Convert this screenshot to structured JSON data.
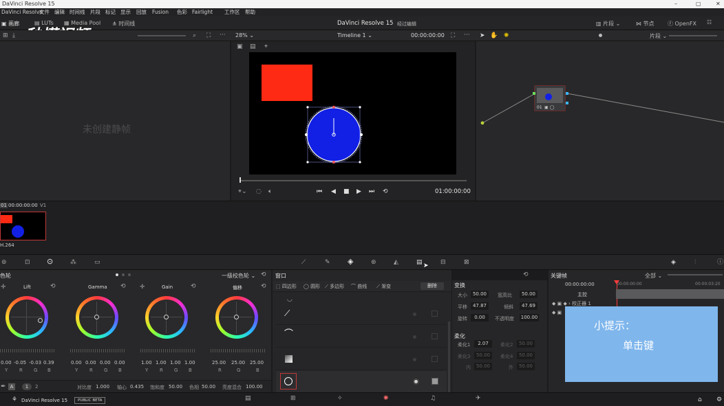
{
  "window": {
    "title": "DaVinci Resolve 15",
    "controls": [
      "–",
      "▢",
      "✕"
    ]
  },
  "menu": [
    "DaVinci Resolve",
    "文件",
    "编辑",
    "时间线",
    "片段",
    "标记",
    "显示",
    "回放",
    "Fusion",
    "色彩",
    "Fairlight",
    "工作区",
    "帮助"
  ],
  "topbar": {
    "left_tabs": [
      "画廊",
      "LUTs",
      "Media Pool",
      "时间线"
    ],
    "project_title": "DaVinci Resolve 15",
    "project_status": "经过编辑",
    "right_tabs": [
      "片段",
      "节点",
      "OpenFX"
    ]
  },
  "watermark": {
    "text": "秒懂视频"
  },
  "viewerbar": {
    "zoom": "28%",
    "timeline_name": "Timeline 1",
    "timecode": "00:00:00:00",
    "node_mode": "片段"
  },
  "gallery": {
    "empty_text": "未创建静帧"
  },
  "viewer": {
    "end_timecode": "01:00:00:00"
  },
  "node": {
    "label": "01"
  },
  "clip": {
    "index": "01",
    "timecode": "00:00:00:00",
    "track": "V1",
    "codec": "H.264"
  },
  "colors": {
    "red_rect": "#ff2a14",
    "blue_circle": "#1220e6",
    "panel_bg": "#28282a",
    "hint_bg": "#7fb6ec"
  },
  "wheels": {
    "panel_title": "色轮",
    "mode": "一级校色轮",
    "items": [
      {
        "name": "Lift",
        "values": [
          "0.00",
          "-0.05",
          "-0.03",
          "0.39"
        ],
        "channels": [
          "Y",
          "R",
          "G",
          "B"
        ]
      },
      {
        "name": "Gamma",
        "values": [
          "0.00",
          "0.00",
          "0.00",
          "0.00"
        ],
        "channels": [
          "Y",
          "R",
          "G",
          "B"
        ]
      },
      {
        "name": "Gain",
        "values": [
          "1.00",
          "1.00",
          "1.00",
          "1.00"
        ],
        "channels": [
          "Y",
          "R",
          "G",
          "B"
        ]
      },
      {
        "name": "偏移",
        "values": [
          "25.00",
          "25.00",
          "25.00"
        ],
        "channels": [
          "R",
          "G",
          "B"
        ]
      }
    ],
    "footer": {
      "page1": "1",
      "page2": "2",
      "contrast_label": "对比度",
      "contrast": "1.000",
      "pivot_label": "轴心",
      "pivot": "0.435",
      "sat_label": "饱和度",
      "sat": "50.00",
      "hue_label": "色相",
      "hue": "50.00",
      "lum_label": "亮度混合",
      "lum": "100.00"
    }
  },
  "window_panel": {
    "title": "窗口",
    "tools": [
      "四边形",
      "圆形",
      "多边形",
      "曲线",
      "渐变"
    ],
    "delete": "删除"
  },
  "transform": {
    "title": "变换",
    "size_label": "大小",
    "size": "50.00",
    "aspect_label": "宽高比",
    "aspect": "50.00",
    "pan_label": "平移",
    "pan": "47.87",
    "tilt_label": "倾斜",
    "tilt": "47.69",
    "rotate_label": "旋转",
    "rotate": "0.00",
    "opacity_label": "不透明度",
    "opacity": "100.00"
  },
  "softness": {
    "title": "柔化",
    "s1_label": "柔化1",
    "s1": "2.07",
    "s2_label": "柔化2",
    "s2": "50.00",
    "s3_label": "柔化3",
    "s3": "50.00",
    "s4_label": "柔化4",
    "s4": "50.00",
    "in_label": "内",
    "in": "50.00",
    "out_label": "外",
    "out": "50.00"
  },
  "keyframes": {
    "title": "关键帧",
    "mode": "全部",
    "start": "00:00:00:00",
    "head": "00:00:00:00",
    "end": "00:00:03:20",
    "master": "主控",
    "track1": "校正器 1"
  },
  "hint": {
    "title": "小提示：",
    "body": "单击键"
  },
  "status": {
    "app": "DaVinci Resolve 15",
    "badge": "PUBLIC BETA"
  }
}
